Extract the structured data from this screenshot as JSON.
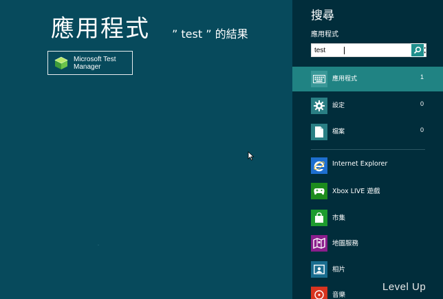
{
  "results": {
    "title": "應用程式",
    "subtitle": "” test ” 的結果",
    "items": [
      {
        "label": "Microsoft Test\nManager",
        "icon": "test-manager-icon"
      }
    ]
  },
  "search": {
    "title": "搜尋",
    "scope_label": "應用程式",
    "query": "test",
    "clear_icon": "close-icon",
    "go_icon": "search-icon",
    "scopes": [
      {
        "label": "應用程式",
        "count": "1",
        "icon": "keyboard-icon",
        "selected": true
      },
      {
        "label": "設定",
        "count": "0",
        "icon": "gear-icon",
        "selected": false
      },
      {
        "label": "檔案",
        "count": "0",
        "icon": "document-icon",
        "selected": false
      }
    ],
    "apps": [
      {
        "label": "Internet Explorer",
        "icon": "internet-explorer-icon",
        "color": "#1e6fcf"
      },
      {
        "label": "Xbox LIVE 遊戲",
        "icon": "game-controller-icon",
        "color": "#1d8c1d"
      },
      {
        "label": "市集",
        "icon": "shopping-bag-icon",
        "color": "#1d9b2e"
      },
      {
        "label": "地圖服務",
        "icon": "map-icon",
        "color": "#8a1e8c"
      },
      {
        "label": "相片",
        "icon": "photo-icon",
        "color": "#1a6d8f"
      },
      {
        "label": "音樂",
        "icon": "music-icon",
        "color": "#d8341f"
      }
    ]
  },
  "watermark": "Level Up",
  "colors": {
    "background": "#074a5c",
    "pane": "#012d3b",
    "selected": "#208383"
  }
}
